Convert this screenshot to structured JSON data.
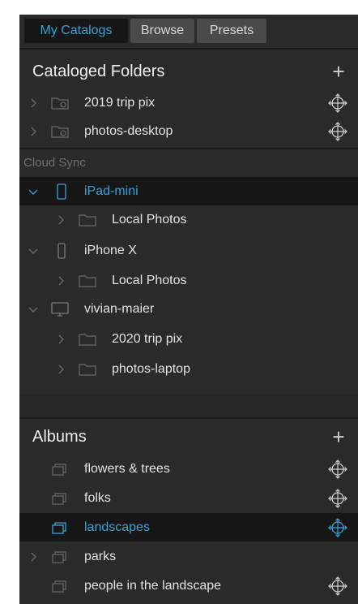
{
  "tabs": [
    {
      "label": "My Catalogs",
      "active": true
    },
    {
      "label": "Browse",
      "active": false
    },
    {
      "label": "Presets",
      "active": false
    }
  ],
  "cataloged": {
    "title": "Cataloged Folders",
    "add_icon": "plus-icon",
    "items": [
      {
        "label": "2019 trip pix",
        "icon": "catalog-folder-icon"
      },
      {
        "label": "photos-desktop",
        "icon": "catalog-folder-icon"
      }
    ]
  },
  "cloud": {
    "section_label": "Cloud Sync",
    "devices": [
      {
        "label": "iPad-mini",
        "icon": "tablet-icon",
        "selected": true,
        "folders": [
          {
            "label": "Local Photos"
          }
        ]
      },
      {
        "label": "iPhone X",
        "icon": "phone-icon",
        "selected": false,
        "folders": [
          {
            "label": "Local Photos"
          }
        ]
      },
      {
        "label": "vivian-maier",
        "icon": "monitor-icon",
        "selected": false,
        "folders": [
          {
            "label": "2020 trip pix"
          },
          {
            "label": "photos-laptop"
          }
        ]
      }
    ]
  },
  "albums": {
    "title": "Albums",
    "add_icon": "plus-icon",
    "items": [
      {
        "label": "flowers & trees",
        "synced": true,
        "selected": false
      },
      {
        "label": "folks",
        "synced": true,
        "selected": false
      },
      {
        "label": "landscapes",
        "synced": true,
        "selected": true
      },
      {
        "label": "parks",
        "synced": false,
        "selected": false,
        "expandable": true
      },
      {
        "label": "people in the landscape",
        "synced": true,
        "selected": false
      }
    ]
  },
  "colors": {
    "accent": "#35a3d9",
    "panel_bg": "#2a2a2a",
    "selected_bg": "#161616",
    "text": "#e3e3e3",
    "muted": "#6f6f6f"
  }
}
